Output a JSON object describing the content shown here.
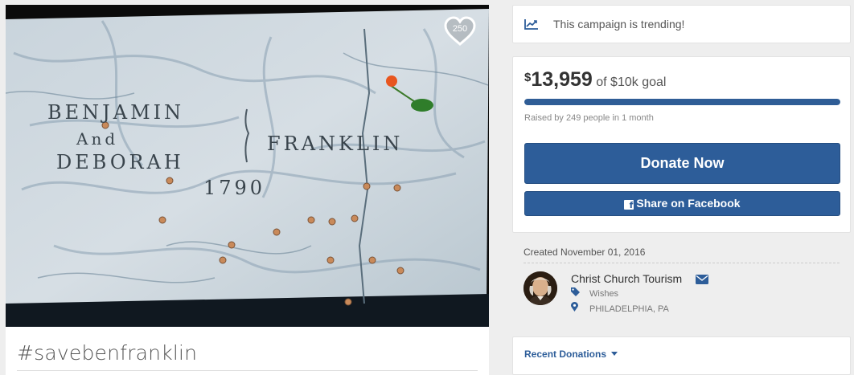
{
  "campaign": {
    "photo": {
      "engraving": {
        "line1": "BENJAMIN",
        "line2": "And",
        "line3": "DEBORAH",
        "surname": "FRANKLIN",
        "year": "1790"
      },
      "likes": "250"
    },
    "title": "#savebenfranklin"
  },
  "trending": {
    "icon": "trending-chart-icon",
    "text": "This campaign is trending!"
  },
  "funding": {
    "currency_symbol": "$",
    "raised": "13,959",
    "goal_text": "of $10k goal",
    "progress_fraction": 1.0,
    "meta": "Raised by 249 people in 1 month",
    "donate_label": "Donate Now",
    "share_label": "Share on Facebook",
    "accent_color": "#2d5d99"
  },
  "organizer": {
    "created": "Created November 01, 2016",
    "name": "Christ Church Tourism",
    "category": "Wishes",
    "location": "PHILADELPHIA, PA"
  },
  "recent": {
    "label": "Recent Donations"
  }
}
